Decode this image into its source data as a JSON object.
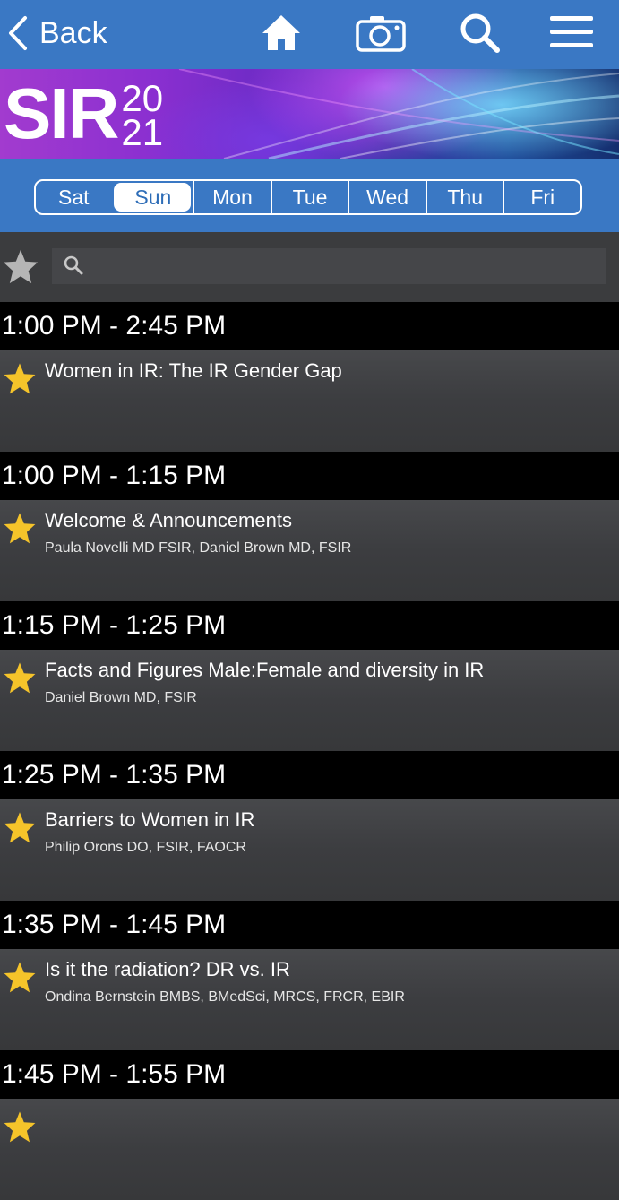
{
  "nav": {
    "back_label": "Back"
  },
  "banner": {
    "logo_text": "SIR",
    "logo_year_top": "20",
    "logo_year_bottom": "21"
  },
  "days": [
    "Sat",
    "Sun",
    "Mon",
    "Tue",
    "Wed",
    "Thu",
    "Fri"
  ],
  "selected_day": "Sun",
  "search": {
    "placeholder": ""
  },
  "sessions": [
    {
      "time": "1:00 PM - 2:45 PM",
      "title": "Women in IR: The IR Gender Gap",
      "speakers": ""
    },
    {
      "time": "1:00 PM - 1:15 PM",
      "title": "Welcome & Announcements",
      "speakers": "Paula Novelli MD FSIR, Daniel Brown MD, FSIR"
    },
    {
      "time": "1:15 PM - 1:25 PM",
      "title": "Facts and Figures Male:Female and diversity in IR",
      "speakers": "Daniel Brown MD, FSIR"
    },
    {
      "time": "1:25 PM - 1:35 PM",
      "title": "Barriers to Women in IR",
      "speakers": "Philip Orons DO, FSIR, FAOCR"
    },
    {
      "time": "1:35 PM - 1:45 PM",
      "title": "Is it the radiation? DR vs. IR",
      "speakers": "Ondina Bernstein BMBS, BMedSci, MRCS, FRCR, EBIR"
    },
    {
      "time": "1:45 PM - 1:55 PM",
      "title": "",
      "speakers": ""
    }
  ],
  "colors": {
    "nav_blue": "#3a78c4",
    "star_gold": "#f5c42a",
    "star_gray": "#b5b5b5"
  }
}
